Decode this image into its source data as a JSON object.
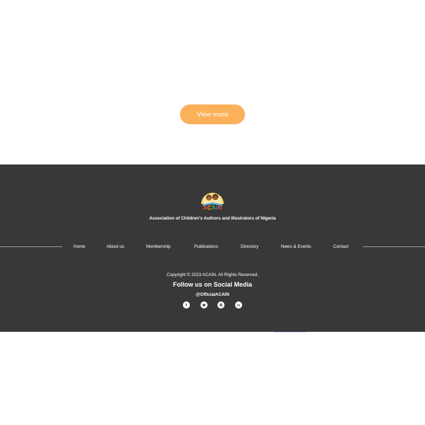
{
  "main": {
    "view_more_label": "View more"
  },
  "footer": {
    "logo_text": [
      "A",
      "C",
      "A",
      "I",
      "N"
    ],
    "logo_colors": [
      "#e94e3c",
      "#f5a623",
      "#4caf50",
      "#2d87c8",
      "#e94e3c"
    ],
    "tagline": "Association of Children's Authors and Illustrators of Nigeria",
    "nav": [
      {
        "label": "Home"
      },
      {
        "label": "About us"
      },
      {
        "label": "Membership"
      },
      {
        "label": "Publications"
      },
      {
        "label": "Directory"
      },
      {
        "label": "News & Events"
      },
      {
        "label": "Contact"
      }
    ],
    "copyright": "Copyright © 2023 ACAIN. All Rights Reserved.",
    "follow_heading": "Follow us on Social Media",
    "handle": "@OfficialACAIN",
    "social": [
      {
        "icon": "facebook-icon"
      },
      {
        "icon": "twitter-icon"
      },
      {
        "icon": "instagram-icon"
      },
      {
        "icon": "linkedin-icon"
      }
    ]
  },
  "colors": {
    "button": "#fbb15a",
    "footer_bg": "#383838"
  }
}
